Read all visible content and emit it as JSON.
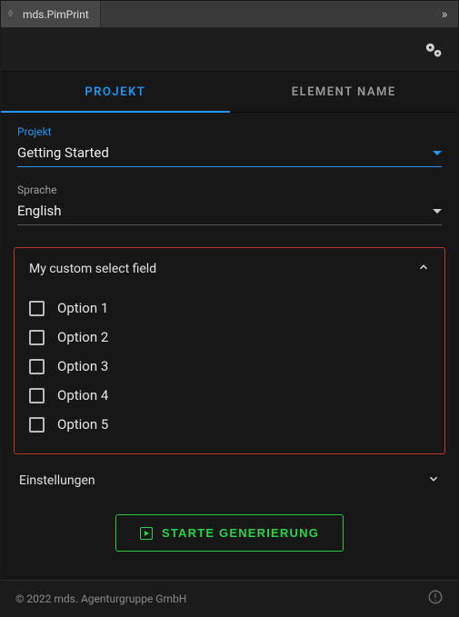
{
  "titlebar": {
    "title": "mds.PimPrint"
  },
  "tabs": [
    {
      "label": "PROJEKT",
      "active": true
    },
    {
      "label": "ELEMENT NAME",
      "active": false
    }
  ],
  "fields": {
    "projekt": {
      "label": "Projekt",
      "value": "Getting Started"
    },
    "sprache": {
      "label": "Sprache",
      "value": "English"
    }
  },
  "customSelect": {
    "title": "My custom select field",
    "options": [
      {
        "label": "Option 1"
      },
      {
        "label": "Option 2"
      },
      {
        "label": "Option 3"
      },
      {
        "label": "Option 4"
      },
      {
        "label": "Option 5"
      }
    ]
  },
  "settings": {
    "label": "Einstellungen"
  },
  "generate": {
    "label": "STARTE GENERIERUNG"
  },
  "footer": {
    "copyright": "© 2022 mds. Agenturgruppe GmbH"
  }
}
